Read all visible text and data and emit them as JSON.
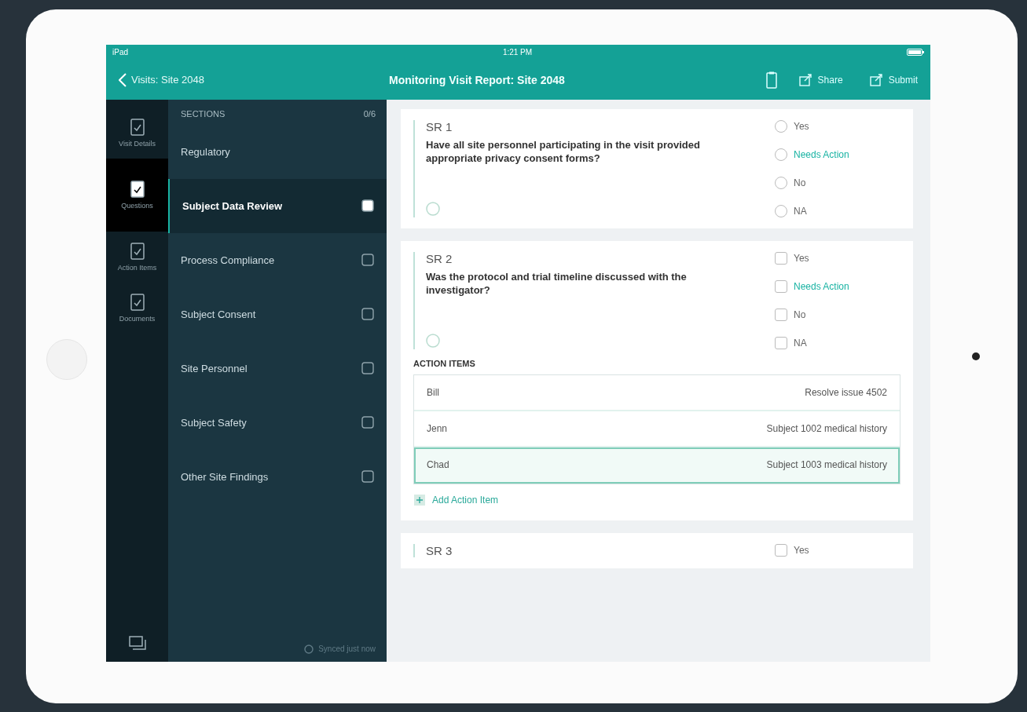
{
  "status_bar": {
    "carrier": "iPad",
    "time": "1:21 PM"
  },
  "nav": {
    "back": "Visits: Site 2048",
    "title": "Monitoring Visit Report: Site 2048",
    "actions": [
      {
        "label": "Share"
      },
      {
        "label": "Submit"
      }
    ]
  },
  "rail": [
    {
      "label": "Visit Details",
      "selected": false
    },
    {
      "label": "Questions",
      "selected": true
    },
    {
      "label": "Action Items",
      "selected": false
    },
    {
      "label": "Documents",
      "selected": false
    }
  ],
  "sidebar": {
    "title": "SECTIONS",
    "count": "0/6",
    "footer": "Synced just now",
    "items": [
      {
        "label": "Regulatory",
        "selected": false,
        "icon": false
      },
      {
        "label": "Subject Data Review",
        "selected": true,
        "icon": true
      },
      {
        "label": "Process Compliance",
        "selected": false,
        "icon": true
      },
      {
        "label": "Subject Consent",
        "selected": false,
        "icon": true
      },
      {
        "label": "Site Personnel",
        "selected": false,
        "icon": true
      },
      {
        "label": "Subject Safety",
        "selected": false,
        "icon": true
      },
      {
        "label": "Other Site Findings",
        "selected": false,
        "icon": true
      }
    ]
  },
  "questions": [
    {
      "code": "SR 1",
      "text": "Have all site personnel participating in the visit provided appropriate privacy consent forms?",
      "kind": "radio",
      "options": [
        {
          "label": "Yes",
          "selected": false,
          "accent": false
        },
        {
          "label": "Needs Action",
          "selected": false,
          "accent": true
        },
        {
          "label": "No",
          "selected": false,
          "accent": false
        },
        {
          "label": "NA",
          "selected": false,
          "accent": false
        }
      ]
    },
    {
      "code": "SR 2",
      "text": "Was the protocol and trial timeline discussed with the investigator?",
      "kind": "checkbox",
      "options": [
        {
          "label": "Yes",
          "selected": false,
          "accent": false
        },
        {
          "label": "Needs Action",
          "selected": false,
          "accent": true
        },
        {
          "label": "No",
          "selected": false,
          "accent": false
        },
        {
          "label": "NA",
          "selected": false,
          "accent": false
        }
      ],
      "action_items": {
        "title": "ACTION ITEMS",
        "add": "Add Action Item",
        "rows": [
          {
            "owner": "Bill",
            "task": "Resolve issue 4502",
            "highlighted": false
          },
          {
            "owner": "Jenn",
            "task": "Subject 1002 medical history",
            "highlighted": false
          },
          {
            "owner": "Chad",
            "task": "Subject 1003 medical history",
            "highlighted": true
          }
        ]
      }
    },
    {
      "code": "SR 3",
      "kind": "checkbox",
      "options": [
        {
          "label": "Yes",
          "selected": false,
          "accent": false
        }
      ]
    }
  ]
}
